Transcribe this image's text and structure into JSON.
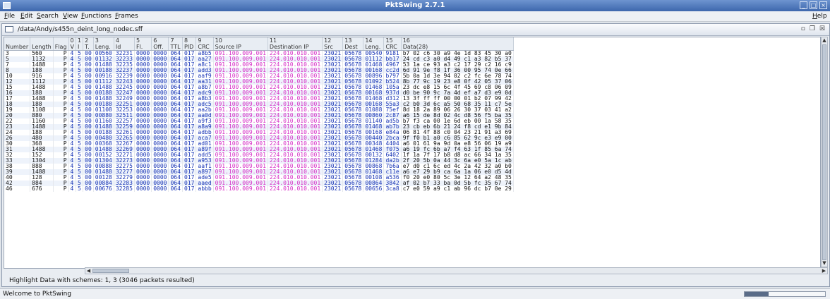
{
  "app": {
    "title": "PktSwing 2.7.1"
  },
  "menu": [
    "File",
    "Edit",
    "Search",
    "View",
    "Functions",
    "Frames"
  ],
  "menu_help": "Help",
  "window": {
    "path": "/data/Andy/s455n_deint_long_nodec.sff"
  },
  "header_groups": [
    {
      "num": "",
      "label": "Number"
    },
    {
      "num": "",
      "label": "Length"
    },
    {
      "num": "",
      "label": "Flag"
    },
    {
      "num": "0",
      "label": "V"
    },
    {
      "num": "1",
      "label": "I"
    },
    {
      "num": "2",
      "label": "T."
    },
    {
      "num": "3",
      "label": "Leng."
    },
    {
      "num": "4",
      "label": "Id"
    },
    {
      "num": "5",
      "label": "Fl."
    },
    {
      "num": "6",
      "label": "Off."
    },
    {
      "num": "7",
      "label": "TTL"
    },
    {
      "num": "8",
      "label": "PID"
    },
    {
      "num": "9",
      "label": "CRC"
    },
    {
      "num": "10",
      "label": "Source IP"
    },
    {
      "num": "11",
      "label": "Destination IP"
    },
    {
      "num": "12",
      "label": "Src"
    },
    {
      "num": "13",
      "label": "Dest"
    },
    {
      "num": "14",
      "label": "Leng."
    },
    {
      "num": "15",
      "label": "CRC"
    },
    {
      "num": "16",
      "label": "Data(28)"
    }
  ],
  "rows": [
    {
      "n": "3",
      "len": "560",
      "flag": "P",
      "leng": "00560",
      "id": "32231",
      "crc9": "a8b5",
      "src": "23021",
      "dst": "05678",
      "l14": "00540",
      "crc15": "9181",
      "hex": "b7 02 c6 30 a9 4e 1d 83 45 30 a0"
    },
    {
      "n": "5",
      "len": "1132",
      "flag": "P",
      "leng": "01132",
      "id": "32233",
      "crc9": "aa27",
      "src": "23021",
      "dst": "05678",
      "l14": "01112",
      "crc15": "bb17",
      "hex": "24 cd c3 a0 d4 49 c1 a3 82 b5 37"
    },
    {
      "n": "7",
      "len": "1488",
      "flag": "P",
      "leng": "01488",
      "id": "32235",
      "crc9": "a8c1",
      "src": "23021",
      "dst": "05678",
      "l14": "01468",
      "crc15": "4967",
      "hex": "53 1a ce 93 a3 c2 17 29 c2 16 c9"
    },
    {
      "n": "8",
      "len": "188",
      "flag": "P",
      "leng": "00188",
      "id": "32237",
      "crc9": "add3",
      "src": "23021",
      "dst": "05678",
      "l14": "00168",
      "crc15": "cc2d",
      "hex": "6d 91 9e f8 1f 36 00 95 74 0e 66"
    },
    {
      "n": "10",
      "len": "916",
      "flag": "P",
      "leng": "00916",
      "id": "32239",
      "crc9": "aaf9",
      "src": "23021",
      "dst": "05678",
      "l14": "00896",
      "crc15": "b797",
      "hex": "5b 0a 1d 3e 94 02 c2 fc 6e 78 74"
    },
    {
      "n": "12",
      "len": "1112",
      "flag": "P",
      "leng": "01112",
      "id": "32243",
      "crc9": "aa31",
      "src": "23021",
      "dst": "05678",
      "l14": "01092",
      "crc15": "b524",
      "hex": "8b 77 9c 19 23 e8 0f 42 05 37 06"
    },
    {
      "n": "15",
      "len": "1488",
      "flag": "P",
      "leng": "01488",
      "id": "32245",
      "crc9": "a8b7",
      "src": "23021",
      "dst": "05678",
      "l14": "01468",
      "crc15": "105a",
      "hex": "23 dc e8 15 6c 4f 45 69 c8 06 09"
    },
    {
      "n": "16",
      "len": "188",
      "flag": "P",
      "leng": "00188",
      "id": "32247",
      "crc9": "adc9",
      "src": "23021",
      "dst": "05678",
      "l14": "00168",
      "crc15": "937d",
      "hex": "d0 be 90 9c 7a 4d ef a7 d3 e9 0d"
    },
    {
      "n": "17",
      "len": "1488",
      "flag": "P",
      "leng": "01488",
      "id": "32249",
      "crc9": "a8b3",
      "src": "23021",
      "dst": "05678",
      "l14": "01468",
      "crc15": "d312",
      "hex": "13 3f ff ff 00 00 01 b2 07 99 42"
    },
    {
      "n": "18",
      "len": "188",
      "flag": "P",
      "leng": "00188",
      "id": "32251",
      "crc9": "adc5",
      "src": "23021",
      "dst": "05678",
      "l14": "00168",
      "crc15": "55a3",
      "hex": "c2 b0 3d 6c a5 50 68 35 11 c7 5e"
    },
    {
      "n": "19",
      "len": "1108",
      "flag": "P",
      "leng": "01108",
      "id": "32253",
      "crc9": "aa2b",
      "src": "23021",
      "dst": "05678",
      "l14": "01088",
      "crc15": "75ef",
      "hex": "8d 18 2a 89 06 26 30 37 03 41 a2"
    },
    {
      "n": "20",
      "len": "880",
      "flag": "P",
      "leng": "00880",
      "id": "32511",
      "crc9": "aa0d",
      "src": "23021",
      "dst": "05678",
      "l14": "00860",
      "crc15": "2c87",
      "hex": "a6 15 de 8d 02 4c d8 56 f5 ba 35"
    },
    {
      "n": "22",
      "len": "1160",
      "flag": "P",
      "leng": "01160",
      "id": "32257",
      "crc9": "a9f3",
      "src": "23021",
      "dst": "05678",
      "l14": "01140",
      "crc15": "ad5b",
      "hex": "b7 f3 ca 00 1e 6d eb 00 1a 58 35"
    },
    {
      "n": "23",
      "len": "1488",
      "flag": "P",
      "leng": "01488",
      "id": "32259",
      "crc9": "a8a9",
      "src": "23021",
      "dst": "05678",
      "l14": "01468",
      "crc15": "ab7b",
      "hex": "23 cb eb 6b 21 24 f8 cd e1 9b 84"
    },
    {
      "n": "24",
      "len": "188",
      "flag": "P",
      "leng": "00188",
      "id": "32261",
      "crc9": "adbb",
      "src": "23021",
      "dst": "05678",
      "l14": "00168",
      "crc15": "e84a",
      "hex": "06 81 4f 88 c0 04 23 21 91 a3 69"
    },
    {
      "n": "26",
      "len": "480",
      "flag": "P",
      "leng": "00480",
      "id": "32265",
      "crc9": "aca7",
      "src": "23021",
      "dst": "05678",
      "l14": "00440",
      "crc15": "2bca",
      "hex": "9f f0 b1 a0 c6 85 62 9c e3 e9 00"
    },
    {
      "n": "30",
      "len": "368",
      "flag": "P",
      "leng": "00368",
      "id": "32267",
      "crc9": "ad01",
      "src": "23021",
      "dst": "05678",
      "l14": "00348",
      "crc15": "4404",
      "hex": "a6 01 61 9a 9d 0a e8 56 06 19 a9"
    },
    {
      "n": "31",
      "len": "1488",
      "flag": "P",
      "leng": "01488",
      "id": "32269",
      "crc9": "a89f",
      "src": "23021",
      "dst": "05678",
      "l14": "01468",
      "crc15": "f075",
      "hex": "a6 19 fc 6b a7 f4 63 1f 85 6a 74"
    },
    {
      "n": "32",
      "len": "152",
      "flag": "P",
      "leng": "00152",
      "id": "32271",
      "crc9": "add5",
      "src": "23021",
      "dst": "05678",
      "l14": "00132",
      "crc15": "6402",
      "hex": "1f 1a 7f 17 b8 d8 ac 66 34 1a 35"
    },
    {
      "n": "33",
      "len": "1304",
      "flag": "P",
      "leng": "01304",
      "id": "32273",
      "crc9": "a953",
      "src": "23021",
      "dst": "05678",
      "l14": "01284",
      "crc15": "da2b",
      "hex": "2f 20 5b 0a 44 3c 6a e0 5a 1c ab"
    },
    {
      "n": "38",
      "len": "888",
      "flag": "P",
      "leng": "00888",
      "id": "32275",
      "crc9": "aaf1",
      "src": "23021",
      "dst": "05678",
      "l14": "00868",
      "crc15": "7b6a",
      "hex": "e7 d0 c1 6c ed 4c 2a 42 32 a0 b0"
    },
    {
      "n": "39",
      "len": "1488",
      "flag": "P",
      "leng": "01488",
      "id": "32277",
      "crc9": "a897",
      "src": "23021",
      "dst": "05678",
      "l14": "01468",
      "crc15": "c11e",
      "hex": "a6 e7 29 b9 ca 6a 1a 06 e0 d5 4d"
    },
    {
      "n": "40",
      "len": "128",
      "flag": "P",
      "leng": "00128",
      "id": "32279",
      "crc9": "ade5",
      "src": "23021",
      "dst": "05678",
      "l14": "00108",
      "crc15": "a536",
      "hex": "f0 20 e0 80 5c 3e 12 64 a2 48 35"
    },
    {
      "n": "42",
      "len": "884",
      "flag": "P",
      "leng": "00884",
      "id": "32283",
      "crc9": "aaed",
      "src": "23021",
      "dst": "05678",
      "l14": "00864",
      "crc15": "3842",
      "hex": "af 02 b7 33 ba 0d 5b fc 35 67 74"
    },
    {
      "n": "46",
      "len": "676",
      "flag": "P",
      "leng": "00676",
      "id": "32285",
      "crc9": "abbb",
      "src": "23021",
      "dst": "05678",
      "l14": "00656",
      "crc15": "3ca8",
      "hex": "c7 e0 59 a9 c1 ab 96 dc b7 0e 29"
    }
  ],
  "fixed": {
    "v": "4",
    "i": "5",
    "t": "00",
    "fl": "0000",
    "off": "0000",
    "ttl": "064",
    "pid": "017",
    "source_ip": "091.100.009.001",
    "dest_ip": "224.010.010.001"
  },
  "status": {
    "highlight": "Highlight Data with schemes: 1, 3  (3046 packets resulted)",
    "welcome": "Welcome to PktSwing"
  },
  "progress": 0.3
}
